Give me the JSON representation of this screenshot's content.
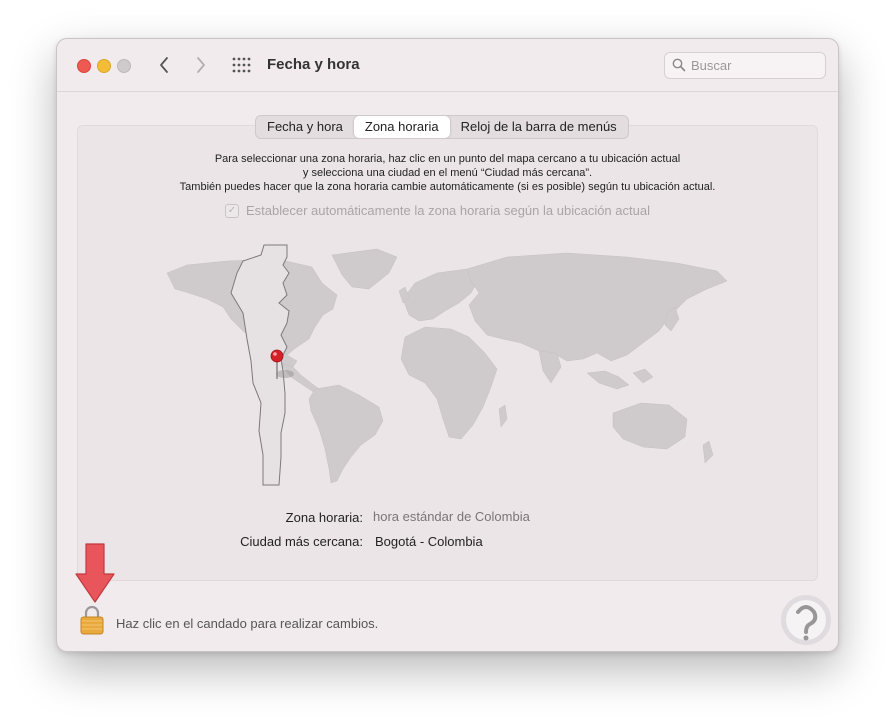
{
  "window": {
    "title": "Fecha y hora",
    "search_placeholder": "Buscar"
  },
  "icons": {
    "back": "chevron-left-icon",
    "forward": "chevron-right-icon",
    "all_prefs": "grid-icon",
    "search": "magnifier-icon",
    "lock": "padlock-icon",
    "pin": "map-pin-icon"
  },
  "tabs": [
    {
      "label": "Fecha y hora",
      "selected": false
    },
    {
      "label": "Zona horaria",
      "selected": true
    },
    {
      "label": "Reloj de la barra de menús",
      "selected": false
    }
  ],
  "instructions": {
    "line1": "Para seleccionar una zona horaria, haz clic en un punto del mapa cercano a tu ubicación actual",
    "line2": "y selecciona una ciudad en el menú “Ciudad más cercana”.",
    "line3": "También puedes hacer que la zona horaria cambie automáticamente (si es posible) según tu ubicación actual."
  },
  "auto_timezone": {
    "label": "Establecer automáticamente la zona horaria según la ubicación actual",
    "checked": true,
    "enabled": false
  },
  "details": {
    "timezone_label": "Zona horaria:",
    "timezone_value": "hora estándar de Colombia",
    "city_label": "Ciudad más cercana:",
    "city_value": "Bogotá - Colombia"
  },
  "footer": {
    "lock_message": "Haz clic en el candado para realizar cambios."
  },
  "colors": {
    "close": "#ee5a52",
    "minimize": "#f4bd37",
    "arrow": "#e8555a",
    "pin": "#d5202a",
    "lock": "#e9a93c"
  }
}
